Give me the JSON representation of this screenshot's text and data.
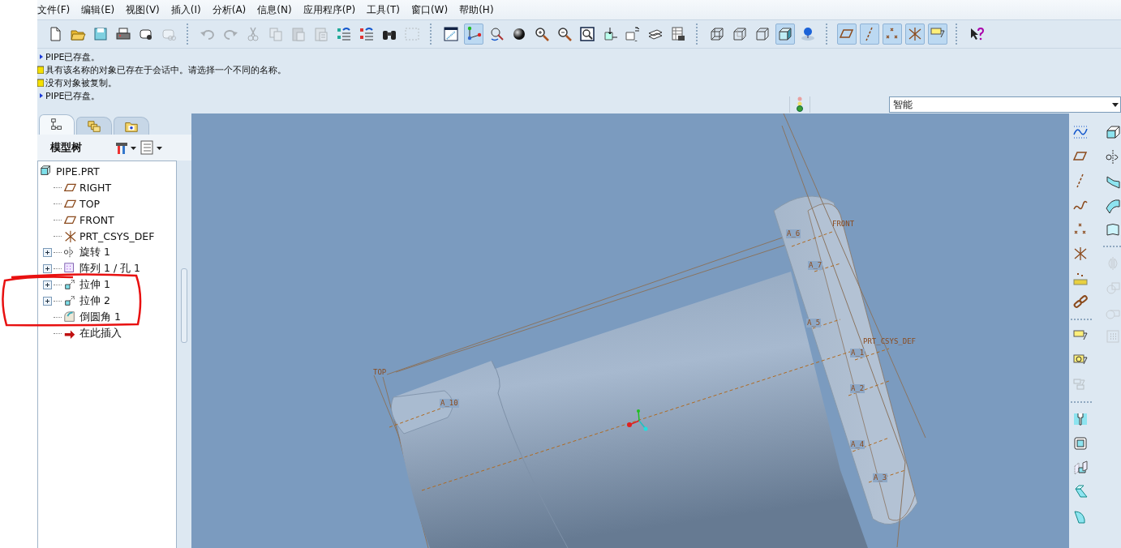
{
  "menu": [
    "文件(F)",
    "编辑(E)",
    "视图(V)",
    "插入(I)",
    "分析(A)",
    "信息(N)",
    "应用程序(P)",
    "工具(T)",
    "窗口(W)",
    "帮助(H)"
  ],
  "toolbar": {
    "groups": [
      [
        {
          "kind": "new",
          "on": false,
          "disabled": false
        },
        {
          "kind": "open",
          "on": false,
          "disabled": false
        },
        {
          "kind": "save",
          "on": false,
          "disabled": false
        },
        {
          "kind": "print",
          "on": false,
          "disabled": false
        },
        {
          "kind": "mail",
          "on": false,
          "disabled": false
        },
        {
          "kind": "mail_link",
          "on": false,
          "disabled": true
        }
      ],
      [
        {
          "kind": "undo",
          "on": false,
          "disabled": true
        },
        {
          "kind": "redo",
          "on": false,
          "disabled": true
        },
        {
          "kind": "cut",
          "on": false,
          "disabled": true
        },
        {
          "kind": "copy",
          "on": false,
          "disabled": true
        },
        {
          "kind": "paste",
          "on": false,
          "disabled": true
        },
        {
          "kind": "paste_special",
          "on": false,
          "disabled": true
        },
        {
          "kind": "regen",
          "on": false,
          "disabled": false
        },
        {
          "kind": "regen_list",
          "on": false,
          "disabled": false
        },
        {
          "kind": "find",
          "on": false,
          "disabled": false
        },
        {
          "kind": "select",
          "on": false,
          "disabled": true
        }
      ],
      [
        {
          "kind": "repaint",
          "on": false,
          "disabled": false
        },
        {
          "kind": "spin",
          "on": true,
          "disabled": false
        },
        {
          "kind": "orient",
          "on": false,
          "disabled": false
        },
        {
          "kind": "sphere",
          "on": false,
          "disabled": false
        },
        {
          "kind": "zoom_in",
          "on": false,
          "disabled": false
        },
        {
          "kind": "zoom_out",
          "on": false,
          "disabled": false
        },
        {
          "kind": "refit",
          "on": false,
          "disabled": false
        },
        {
          "kind": "reorient",
          "on": false,
          "disabled": false
        },
        {
          "kind": "view",
          "on": false,
          "disabled": false
        },
        {
          "kind": "layers",
          "on": false,
          "disabled": false
        },
        {
          "kind": "table",
          "on": false,
          "disabled": false
        }
      ],
      [
        {
          "kind": "wire",
          "on": false,
          "disabled": false
        },
        {
          "kind": "hidden",
          "on": false,
          "disabled": false
        },
        {
          "kind": "nohidden",
          "on": false,
          "disabled": false
        },
        {
          "kind": "shaded",
          "on": true,
          "disabled": false
        },
        {
          "kind": "realism",
          "on": false,
          "disabled": false
        }
      ],
      [
        {
          "kind": "plane",
          "on": true,
          "disabled": false
        },
        {
          "kind": "axis",
          "on": true,
          "disabled": false
        },
        {
          "kind": "point",
          "on": true,
          "disabled": false
        },
        {
          "kind": "csys",
          "on": true,
          "disabled": false
        },
        {
          "kind": "annot",
          "on": true,
          "disabled": false
        }
      ],
      [
        {
          "kind": "help",
          "on": false,
          "disabled": false
        }
      ]
    ]
  },
  "messages": [
    {
      "kind": "info",
      "text": "PIPE已存盘。"
    },
    {
      "kind": "warning",
      "text": "具有该名称的对象已存在于会话中。请选择一个不同的名称。"
    },
    {
      "kind": "warning",
      "text": "没有对象被复制。"
    },
    {
      "kind": "info",
      "text": "PIPE已存盘。"
    }
  ],
  "filter": {
    "value": "智能"
  },
  "nav_tabs": [
    {
      "kind": "tree",
      "selected": true
    },
    {
      "kind": "folder",
      "selected": false
    },
    {
      "kind": "favorites",
      "selected": false
    }
  ],
  "model_tree": {
    "title": "模型树",
    "items": [
      {
        "kind": "part",
        "label": "PIPE.PRT",
        "expandable": false
      },
      {
        "kind": "plane",
        "label": "RIGHT",
        "expandable": false
      },
      {
        "kind": "plane",
        "label": "TOP",
        "expandable": false
      },
      {
        "kind": "plane",
        "label": "FRONT",
        "expandable": false
      },
      {
        "kind": "csys",
        "label": "PRT_CSYS_DEF",
        "expandable": false
      },
      {
        "kind": "revolve",
        "label": "旋转 1",
        "expandable": true
      },
      {
        "kind": "pattern",
        "label": "阵列 1 / 孔 1",
        "expandable": true
      },
      {
        "kind": "extrude",
        "label": "拉伸 1",
        "expandable": true
      },
      {
        "kind": "extrude",
        "label": "拉伸 2",
        "expandable": true
      },
      {
        "kind": "round",
        "label": "倒圆角 1",
        "expandable": false
      },
      {
        "kind": "insert",
        "label": "在此插入",
        "expandable": false
      }
    ]
  },
  "viewport": {
    "datum_labels": [
      "TOP",
      "FRONT",
      "A_6",
      "A_7",
      "A_5",
      "PRT_CSYS_DEF",
      "A_1",
      "A_2",
      "A_4",
      "A_3",
      "A_10"
    ]
  },
  "right_toolbar": {
    "columns": [
      [
        {
          "kind": "sketch",
          "disabled": false
        },
        {
          "kind": "plane",
          "disabled": false
        },
        {
          "kind": "axis",
          "disabled": false
        },
        {
          "kind": "curve",
          "disabled": false
        },
        {
          "kind": "point",
          "disabled": false
        },
        {
          "kind": "csys",
          "disabled": false
        },
        {
          "kind": "analysis",
          "disabled": false
        },
        {
          "kind": "chain",
          "disabled": false
        },
        {
          "kind": "sep"
        },
        {
          "kind": "annot",
          "disabled": false
        },
        {
          "kind": "annot_a",
          "disabled": false
        },
        {
          "kind": "annot_list",
          "disabled": true
        },
        {
          "kind": "sep"
        },
        {
          "kind": "hole",
          "disabled": false
        },
        {
          "kind": "shell",
          "disabled": false
        },
        {
          "kind": "rib",
          "disabled": false
        },
        {
          "kind": "draft",
          "disabled": false
        },
        {
          "kind": "roundtool",
          "disabled": false
        }
      ],
      [
        {
          "kind": "extrude",
          "disabled": false
        },
        {
          "kind": "revolve",
          "disabled": false
        },
        {
          "kind": "sweep",
          "disabled": false
        },
        {
          "kind": "blend",
          "disabled": false
        },
        {
          "kind": "boundary",
          "disabled": false
        },
        {
          "kind": "sep"
        },
        {
          "kind": "mirror",
          "disabled": true
        },
        {
          "kind": "merge",
          "disabled": true
        },
        {
          "kind": "trim",
          "disabled": true
        },
        {
          "kind": "patterntool",
          "disabled": true
        }
      ]
    ]
  }
}
